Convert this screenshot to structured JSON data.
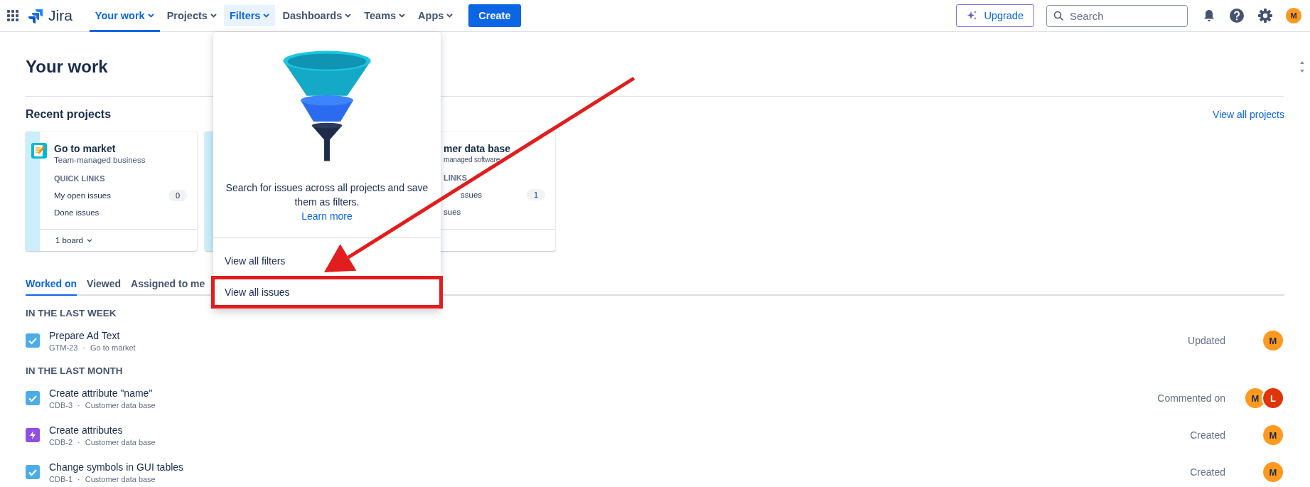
{
  "top_nav": {
    "product": "Jira",
    "items": [
      {
        "label": "Your work",
        "selected": true,
        "open": false
      },
      {
        "label": "Projects",
        "selected": false,
        "open": false
      },
      {
        "label": "Filters",
        "selected": false,
        "open": true
      },
      {
        "label": "Dashboards",
        "selected": false,
        "open": false
      },
      {
        "label": "Teams",
        "selected": false,
        "open": false
      },
      {
        "label": "Apps",
        "selected": false,
        "open": false
      }
    ],
    "create": "Create",
    "upgrade": "Upgrade",
    "search": {
      "placeholder": "Search"
    },
    "avatar": {
      "initial": "M",
      "color": "#ff991f"
    }
  },
  "page": {
    "title": "Your work"
  },
  "recent_projects": {
    "title": "Recent projects",
    "view_all": "View all projects",
    "cards": [
      {
        "kind": "full",
        "name": "Go to market",
        "type": "Team-managed business",
        "quick_links": "QUICK LINKS",
        "links": [
          {
            "label": "My open issues",
            "count": "0"
          },
          {
            "label": "Done issues"
          }
        ],
        "boards": "1 board"
      },
      {
        "kind": "hidden"
      },
      {
        "kind": "clipped",
        "name": "mer data base",
        "type": "managed software",
        "quick_links": "LINKS",
        "links": [
          {
            "label": "ssues",
            "count": "1"
          },
          {
            "label": "sues"
          }
        ]
      }
    ]
  },
  "filters_menu": {
    "description": "Search for issues across all projects and save them as filters.",
    "learn_more": "Learn more",
    "items": [
      {
        "label": "View all filters",
        "highlighted": false
      },
      {
        "label": "View all issues",
        "highlighted": true
      }
    ]
  },
  "tabs": [
    {
      "label": "Worked on",
      "selected": true
    },
    {
      "label": "Viewed",
      "selected": false
    },
    {
      "label": "Assigned to me",
      "selected": false
    }
  ],
  "sections": [
    {
      "title": "IN THE LAST WEEK",
      "items": [
        {
          "title": "Prepare Ad Text",
          "key": "GTM-23",
          "separator": "·",
          "project": "Go to market",
          "kind": "task",
          "action": "Updated",
          "avatars": [
            {
              "initial": "M",
              "color": "#ff991f"
            }
          ]
        }
      ]
    },
    {
      "title": "IN THE LAST MONTH",
      "items": [
        {
          "title": "Create attribute \"name\"",
          "key": "CDB-3",
          "separator": "·",
          "project": "Customer data base",
          "kind": "task",
          "action": "Commented on",
          "avatars": [
            {
              "initial": "M",
              "color": "#ff991f"
            },
            {
              "initial": "L",
              "color": "#de350b"
            }
          ]
        },
        {
          "title": "Create attributes",
          "key": "CDB-2",
          "separator": "·",
          "project": "Customer data base",
          "kind": "epic",
          "action": "Created",
          "avatars": [
            {
              "initial": "M",
              "color": "#ff991f"
            }
          ]
        },
        {
          "title": "Change symbols in GUI tables",
          "key": "CDB-1",
          "separator": "·",
          "project": "Customer data base",
          "kind": "task",
          "action": "Created",
          "avatars": [
            {
              "initial": "M",
              "color": "#ff991f"
            }
          ]
        }
      ]
    }
  ]
}
